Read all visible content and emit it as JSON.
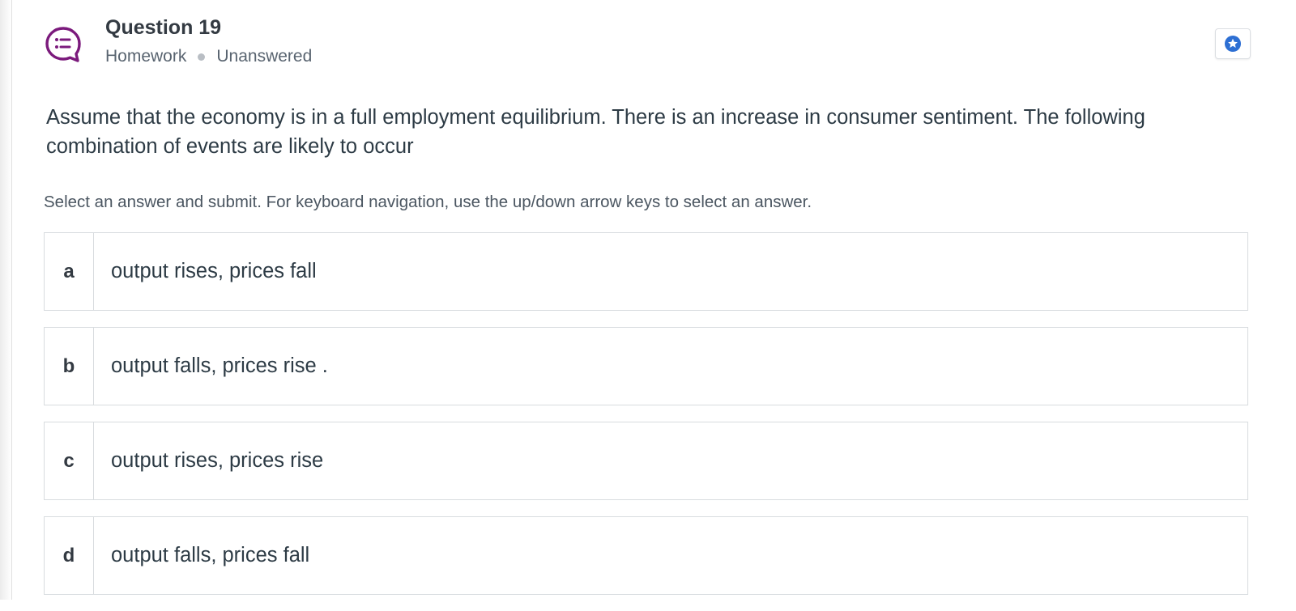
{
  "question": {
    "title": "Question 19",
    "type": "Homework",
    "status": "Unanswered",
    "icon": "question-chat-icon",
    "bookmark_icon": "star-bookmark-icon"
  },
  "prompt": "Assume that the economy is in a full employment equilibrium. There is an increase in consumer sentiment. The following combination of events are likely to occur",
  "instructions": "Select an answer and submit. For keyboard navigation, use the up/down arrow keys to select an answer.",
  "options": [
    {
      "letter": "a",
      "text": "output rises, prices fall"
    },
    {
      "letter": "b",
      "text": "output falls, prices rise ."
    },
    {
      "letter": "c",
      "text": "output rises, prices rise"
    },
    {
      "letter": "d",
      "text": "output falls, prices fall"
    }
  ],
  "colors": {
    "icon_purple": "#7b1a7c",
    "bookmark_blue": "#2d6fd3",
    "border": "#d8dcdf",
    "text": "#2d3b45"
  }
}
